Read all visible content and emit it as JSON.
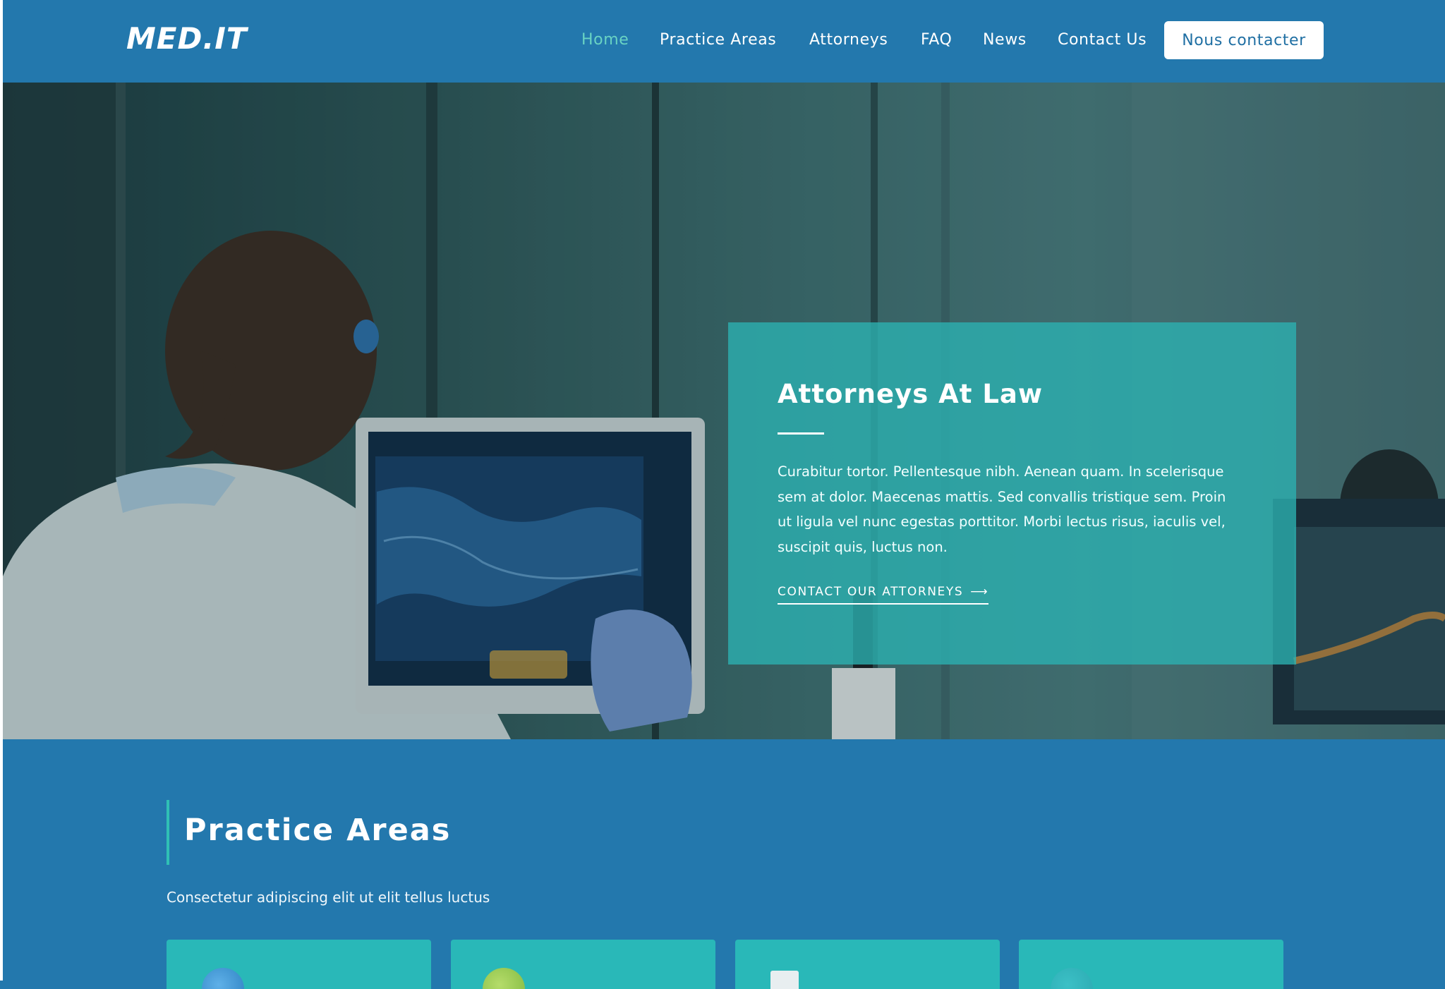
{
  "header": {
    "logo": "MED.IT",
    "nav": [
      {
        "label": "Home",
        "active": true
      },
      {
        "label": "Practice Areas",
        "active": false
      },
      {
        "label": "Attorneys",
        "active": false
      },
      {
        "label": "FAQ",
        "active": false
      },
      {
        "label": "News",
        "active": false
      },
      {
        "label": "Contact Us",
        "active": false
      }
    ],
    "cta_label": "Nous contacter"
  },
  "hero": {
    "title": "Attorneys At Law",
    "text": "Curabitur tortor. Pellentesque nibh. Aenean quam. In scelerisque sem at dolor. Maecenas mattis. Sed convallis tristique sem. Proin ut ligula vel nunc egestas porttitor. Morbi lectus risus, iaculis vel, suscipit quis, luctus non.",
    "link_label": "CONTACT OUR ATTORNEYS",
    "link_arrow": "⟶"
  },
  "practice_areas": {
    "title": "Practice Areas",
    "subtitle": "Consectetur adipiscing elit ut elit tellus luctus",
    "cards": [
      {
        "icon": "globe-icon",
        "icon_color": "#3a8fd0"
      },
      {
        "icon": "leaf-icon",
        "icon_color": "#8cc34a"
      },
      {
        "icon": "document-icon",
        "icon_color": "#e8eef0"
      },
      {
        "icon": "lightbulb-icon",
        "icon_color": "#2aa8b0"
      }
    ]
  },
  "colors": {
    "primary": "#2378ad",
    "accent": "#2fc0b5",
    "card": "#29b8b8",
    "active_nav": "#69d3c3"
  }
}
